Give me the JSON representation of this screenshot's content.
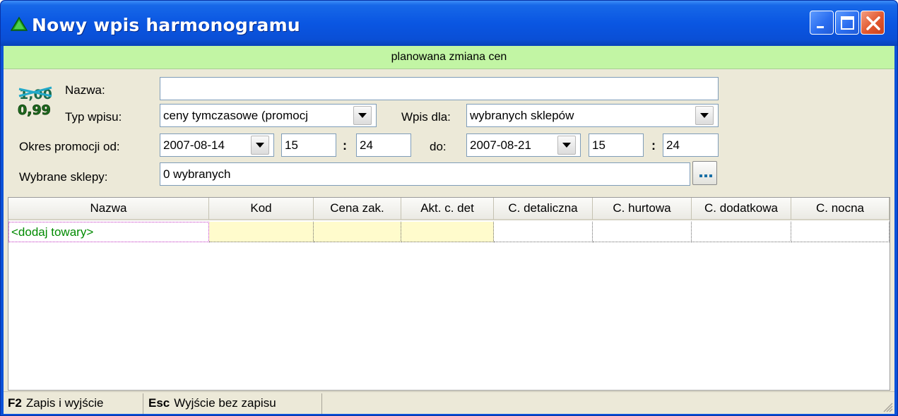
{
  "window": {
    "title": "Nowy wpis harmonogramu",
    "icon": "green-triangle-icon",
    "buttons": [
      "minimize-icon",
      "maximize-icon",
      "close-icon"
    ]
  },
  "banner": {
    "text": "planowana zmiana cen"
  },
  "form": {
    "price_icon": {
      "old_price": "1,00",
      "new_price": "0,99"
    },
    "name_label": "Nazwa:",
    "name_value": "",
    "type_label": "Typ wpisu:",
    "type_value": "ceny tymczasowe (promocj",
    "entry_for_label": "Wpis dla:",
    "entry_for_value": "wybranych sklepów",
    "period_label": "Okres promocji od:",
    "from_date": "2007-08-14",
    "from_hour": "15",
    "from_minute": "24",
    "time_sep": ":",
    "to_label": "do:",
    "to_date": "2007-08-21",
    "to_hour": "15",
    "to_minute": "24",
    "shops_label": "Wybrane sklepy:",
    "shops_value": "0 wybranych"
  },
  "grid": {
    "columns": [
      "Nazwa",
      "Kod",
      "Cena zak.",
      "Akt. c. det",
      "C. detaliczna",
      "C. hurtowa",
      "C. dodatkowa",
      "C. nocna"
    ],
    "rows": [
      [
        "<dodaj towary>",
        "",
        "",
        "",
        "",
        "",
        "",
        ""
      ]
    ]
  },
  "statusbar": {
    "save_key": "F2",
    "save_label": "Zapis i wyjście",
    "exit_key": "Esc",
    "exit_label": "Wyjście bez zapisu"
  },
  "colors": {
    "titlebar": "#0a56e2",
    "banner": "#c2f5a4",
    "add_row_text": "#008a00",
    "yellow_cell": "#fffbcc"
  }
}
